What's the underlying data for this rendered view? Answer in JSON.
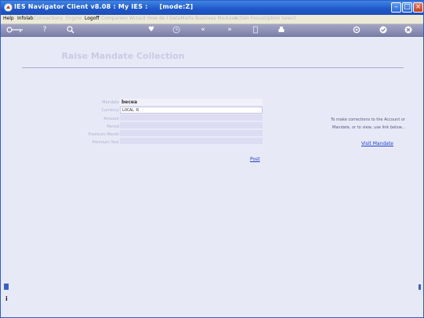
{
  "window": {
    "title": "IES Navigator Client v8.08 : My IES :",
    "mode": "[mode:Z]"
  },
  "menu": [
    {
      "label": "Help",
      "active": true
    },
    {
      "label": "Infolab",
      "active": true
    },
    {
      "label": "Connections",
      "active": false
    },
    {
      "label": "Engine",
      "active": false
    },
    {
      "label": "Logoff",
      "active": true
    },
    {
      "label": "Companion",
      "active": false
    },
    {
      "label": "Wizard",
      "active": false
    },
    {
      "label": "How do I",
      "active": false
    },
    {
      "label": "DataMarts",
      "active": false
    },
    {
      "label": "Business Modules",
      "active": false
    },
    {
      "label": "Action Focus",
      "active": false
    },
    {
      "label": "Option Select",
      "active": false
    }
  ],
  "toolbar_icons": [
    "key-icon",
    "help-icon",
    "search-icon",
    "heart-icon",
    "clock-icon",
    "back-icon",
    "forward-icon",
    "document-icon",
    "printer-icon",
    "refresh-icon",
    "check-icon",
    "close-icon"
  ],
  "page_title": "Raise Mandate Collection",
  "form": {
    "fields": [
      {
        "label": "Mandate",
        "value": "becea"
      },
      {
        "label": "Currency",
        "value": "LOCAL R"
      },
      {
        "label": "Amount",
        "value": ""
      },
      {
        "label": "Period",
        "value": ""
      },
      {
        "label": "Premium Month",
        "value": ""
      },
      {
        "label": "Premium Year",
        "value": ""
      }
    ],
    "post_label": "Post"
  },
  "side_note": {
    "line1": "To make corrections to the Account or",
    "line2": "Mandate, or to view, use link below...",
    "link_label": "Visit Mandate"
  },
  "bottom_left_label": "i"
}
